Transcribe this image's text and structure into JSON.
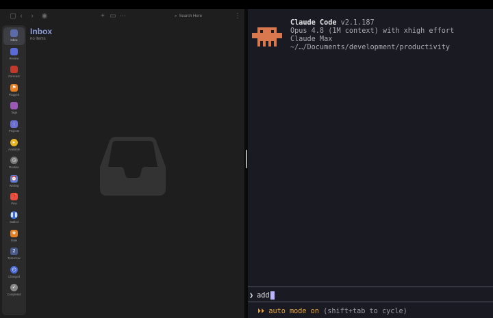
{
  "left_app": {
    "toolbar": {
      "search_placeholder": "Search Here"
    },
    "sidebar": {
      "items": [
        {
          "label": "Inbox",
          "icon": "inbox-icon",
          "color": "#5b6aa8",
          "glyph": "",
          "active": true
        },
        {
          "label": "Review",
          "icon": "review-icon",
          "color": "#5a6bd6",
          "glyph": ""
        },
        {
          "label": "Forecast",
          "icon": "forecast-icon",
          "color": "#c0392b",
          "glyph": ""
        },
        {
          "label": "Flagged",
          "icon": "flag-icon",
          "color": "#e67e22",
          "glyph": "⚑"
        },
        {
          "label": "Tags",
          "icon": "tag-icon",
          "color": "#9b59b6",
          "glyph": ""
        },
        {
          "label": "Projects",
          "icon": "projects-icon",
          "color": "#6a6fd0",
          "glyph": "⋮"
        },
        {
          "label": "Available",
          "icon": "available-icon",
          "color": "#e6b422",
          "glyph": "▸"
        },
        {
          "label": "Routine",
          "icon": "routine-icon",
          "color": "#777777",
          "glyph": "◷"
        },
        {
          "label": "Waiting",
          "icon": "waiting-icon",
          "color": "#5a7fd6",
          "glyph": "⏰"
        },
        {
          "label": "Pins",
          "icon": "pin-icon",
          "color": "#e74c3c",
          "glyph": "📌"
        },
        {
          "label": "Stalled",
          "icon": "stalled-icon",
          "color": "#3b6fd8",
          "glyph": "❚❚"
        },
        {
          "label": "Stale",
          "icon": "stale-icon",
          "color": "#e67e22",
          "glyph": "❖"
        },
        {
          "label": "Tomorrow",
          "icon": "tomorrow-icon",
          "color": "#4a5a8a",
          "glyph": "2"
        },
        {
          "label": "Changed",
          "icon": "changed-icon",
          "color": "#4a6bd6",
          "glyph": "◴"
        },
        {
          "label": "Completed",
          "icon": "completed-icon",
          "color": "#888888",
          "glyph": "✓"
        }
      ]
    },
    "main": {
      "title": "Inbox",
      "subtitle": "no items"
    }
  },
  "terminal": {
    "app_name": "Claude Code",
    "version": "v2.1.187",
    "model_line": "Opus 4.8 (1M context) with xhigh effort",
    "plan_line": "Claude Max",
    "path_line": "~/…/Documents/development/productivity",
    "prompt_char": "❯",
    "input_value": "add",
    "mode_arrows": "⏵⏵",
    "mode_text": "auto mode on",
    "mode_hint": "(shift+tab to cycle)",
    "colors": {
      "accent": "#e8a33c",
      "cursor": "#b8b4ff",
      "mascot": "#d9774f"
    }
  }
}
